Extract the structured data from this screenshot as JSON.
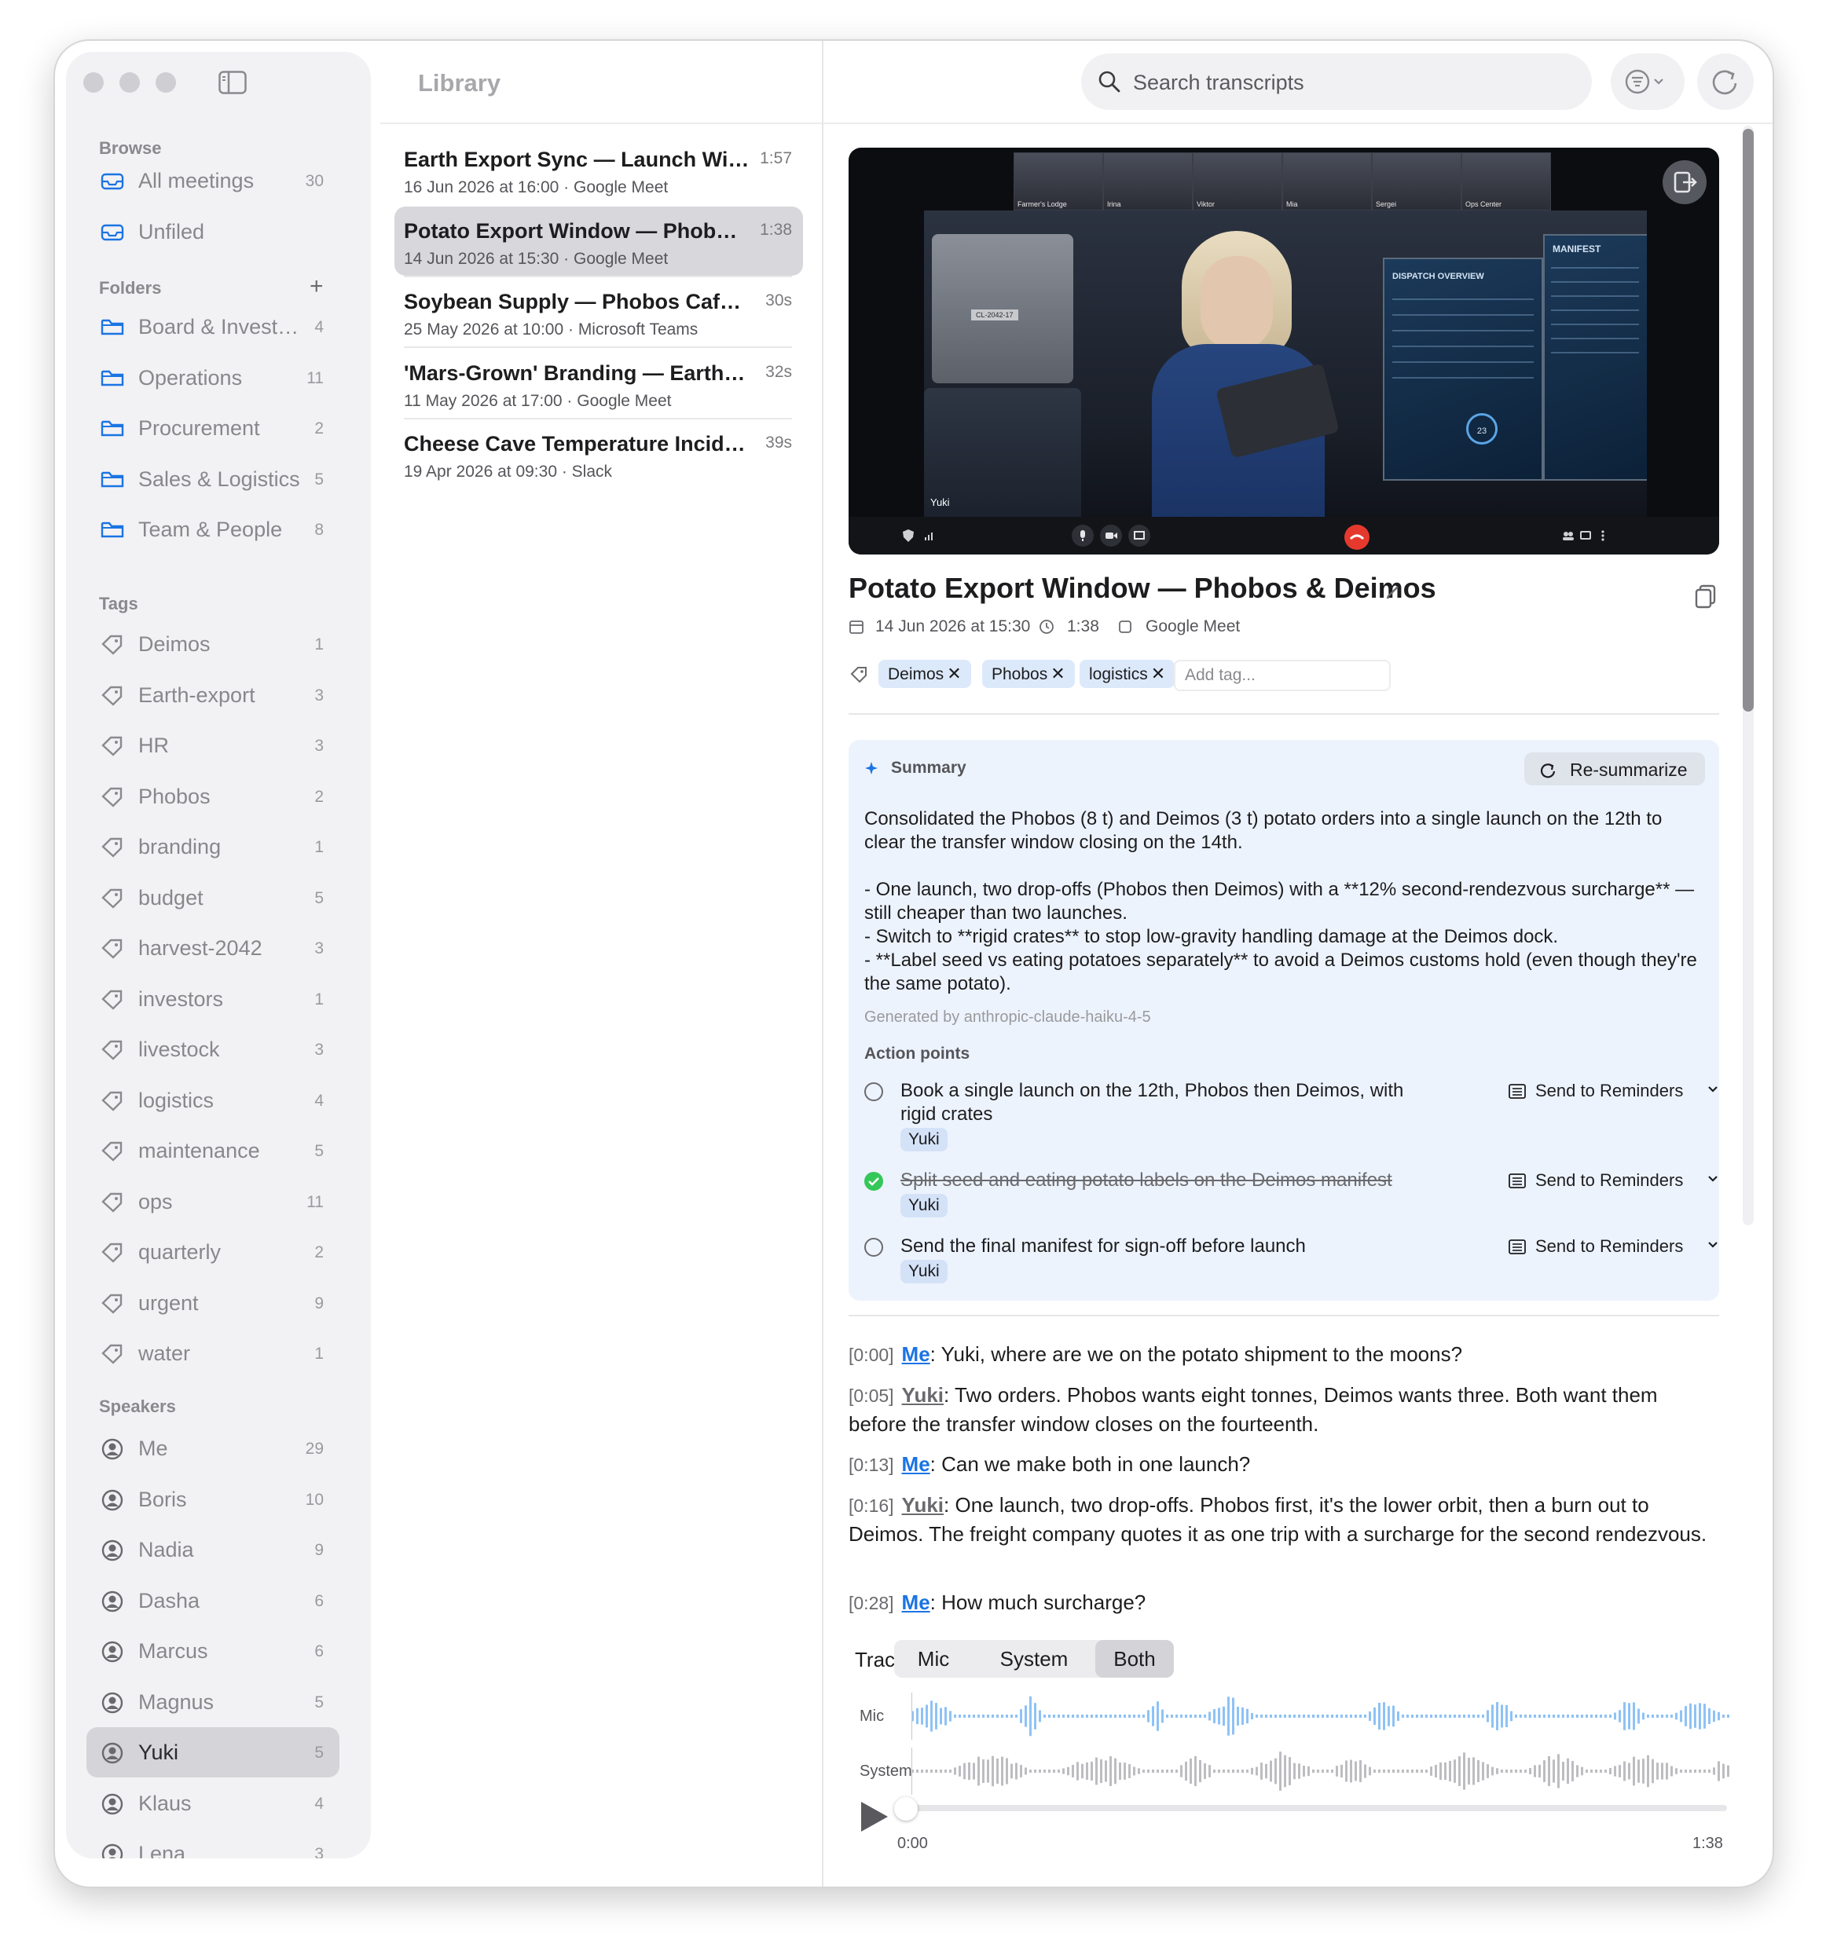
{
  "sidebar": {
    "browse_label": "Browse",
    "browse": [
      {
        "label": "All meetings",
        "count": "30",
        "icon": "tray-icon"
      },
      {
        "label": "Unfiled",
        "count": "",
        "icon": "tray-icon"
      }
    ],
    "folders_label": "Folders",
    "add_folder_glyph": "+",
    "folders": [
      {
        "label": "Board & Investors",
        "count": "4"
      },
      {
        "label": "Operations",
        "count": "11"
      },
      {
        "label": "Procurement",
        "count": "2"
      },
      {
        "label": "Sales & Logistics",
        "count": "5"
      },
      {
        "label": "Team & People",
        "count": "8"
      }
    ],
    "tags_label": "Tags",
    "tags": [
      {
        "label": "Deimos",
        "count": "1"
      },
      {
        "label": "Earth-export",
        "count": "3"
      },
      {
        "label": "HR",
        "count": "3"
      },
      {
        "label": "Phobos",
        "count": "2"
      },
      {
        "label": "branding",
        "count": "1"
      },
      {
        "label": "budget",
        "count": "5"
      },
      {
        "label": "harvest-2042",
        "count": "3"
      },
      {
        "label": "investors",
        "count": "1"
      },
      {
        "label": "livestock",
        "count": "3"
      },
      {
        "label": "logistics",
        "count": "4"
      },
      {
        "label": "maintenance",
        "count": "5"
      },
      {
        "label": "ops",
        "count": "11"
      },
      {
        "label": "quarterly",
        "count": "2"
      },
      {
        "label": "urgent",
        "count": "9"
      },
      {
        "label": "water",
        "count": "1"
      }
    ],
    "speakers_label": "Speakers",
    "speakers": [
      {
        "label": "Me",
        "count": "29"
      },
      {
        "label": "Boris",
        "count": "10"
      },
      {
        "label": "Nadia",
        "count": "9"
      },
      {
        "label": "Dasha",
        "count": "6"
      },
      {
        "label": "Marcus",
        "count": "6"
      },
      {
        "label": "Magnus",
        "count": "5"
      },
      {
        "label": "Yuki",
        "count": "5"
      },
      {
        "label": "Klaus",
        "count": "4"
      },
      {
        "label": "Lena",
        "count": "3"
      }
    ],
    "selected_speaker": "Yuki"
  },
  "library": {
    "title": "Library",
    "meetings": [
      {
        "title": "Earth Export Sync — Launch Window",
        "duration": "1:57",
        "sub": "16 Jun 2026 at 16:00  ·  Google Meet"
      },
      {
        "title": "Potato Export Window — Phobos & Deimos",
        "duration": "1:38",
        "sub": "14 Jun 2026 at 15:30  ·  Google Meet"
      },
      {
        "title": "Soybean Supply — Phobos Cafeteria",
        "duration": "30s",
        "sub": "25 May 2026 at 10:00  ·  Microsoft Teams"
      },
      {
        "title": "'Mars-Grown' Branding — Earth Market",
        "duration": "32s",
        "sub": "11 May 2026 at 17:00  ·  Google Meet"
      },
      {
        "title": "Cheese Cave Temperature Incident",
        "duration": "39s",
        "sub": "19 Apr 2026 at 09:30  ·  Slack"
      }
    ]
  },
  "search": {
    "placeholder": "Search transcripts"
  },
  "video": {
    "participants": [
      "Farmer's Lodge",
      "Irina",
      "Viktor",
      "Mia",
      "Sergei",
      "Ops Center"
    ],
    "speaker": "Yuki",
    "panel_left_title": "DISPATCH OVERVIEW",
    "panel_right_title": "MANIFEST",
    "gauge": "23",
    "crate_label": "CL-2042-17"
  },
  "meeting": {
    "title": "Potato Export Window — Phobos & Deimos",
    "date": "14 Jun 2026 at 15:30",
    "duration": "1:38",
    "platform": "Google Meet",
    "tags": [
      "Deimos",
      "Phobos",
      "logistics"
    ],
    "add_tag_placeholder": "Add tag..."
  },
  "summary": {
    "label": "Summary",
    "resummarize": "Re-summarize",
    "text": "Consolidated the Phobos (8 t) and Deimos (3 t) potato orders into a single launch on the 12th to clear the transfer window closing on the 14th.\n\n- One launch, two drop-offs (Phobos then Deimos) with a **12% second-rendezvous surcharge** — still cheaper than two launches.\n- Switch to **rigid crates** to stop low-gravity handling damage at the Deimos dock.\n- **Label seed vs eating potatoes separately** to avoid a Deimos customs hold (even though they're the same potato).",
    "generated_by": "Generated by anthropic-claude-haiku-4-5",
    "action_points_label": "Action points",
    "send_label": "Send to Reminders",
    "action_points": [
      {
        "text": "Book a single launch on the 12th, Phobos then Deimos, with rigid crates",
        "assignee": "Yuki",
        "done": false
      },
      {
        "text": "Split seed and eating potato labels on the Deimos manifest",
        "assignee": "Yuki",
        "done": true
      },
      {
        "text": "Send the final manifest for sign-off before launch",
        "assignee": "Yuki",
        "done": false
      }
    ]
  },
  "transcript": [
    {
      "time": "[0:00]",
      "speaker": "Me",
      "text": ": Yuki, where are we on the potato shipment to the moons?"
    },
    {
      "time": "[0:05]",
      "speaker": "Yuki",
      "text": ": Two orders. Phobos wants eight tonnes, Deimos wants three. Both want them before the transfer window closes on the fourteenth."
    },
    {
      "time": "[0:13]",
      "speaker": "Me",
      "text": ": Can we make both in one launch?"
    },
    {
      "time": "[0:16]",
      "speaker": "Yuki",
      "text": ": One launch, two drop-offs. Phobos first, it's the lower orbit, then a burn out to Deimos. The freight company quotes it as one trip with a surcharge for the second rendezvous."
    },
    {
      "time": "[0:28]",
      "speaker": "Me",
      "text": ": How much surcharge?"
    }
  ],
  "player": {
    "track_label": "Track",
    "tracks": [
      "Mic",
      "System",
      "Both"
    ],
    "selected_track": "Both",
    "mic_label": "Mic",
    "system_label": "System",
    "current_time": "0:00",
    "total_time": "1:38",
    "progress": 0,
    "mic_color": "#8ec2f5",
    "system_color": "#bdbdc1"
  }
}
